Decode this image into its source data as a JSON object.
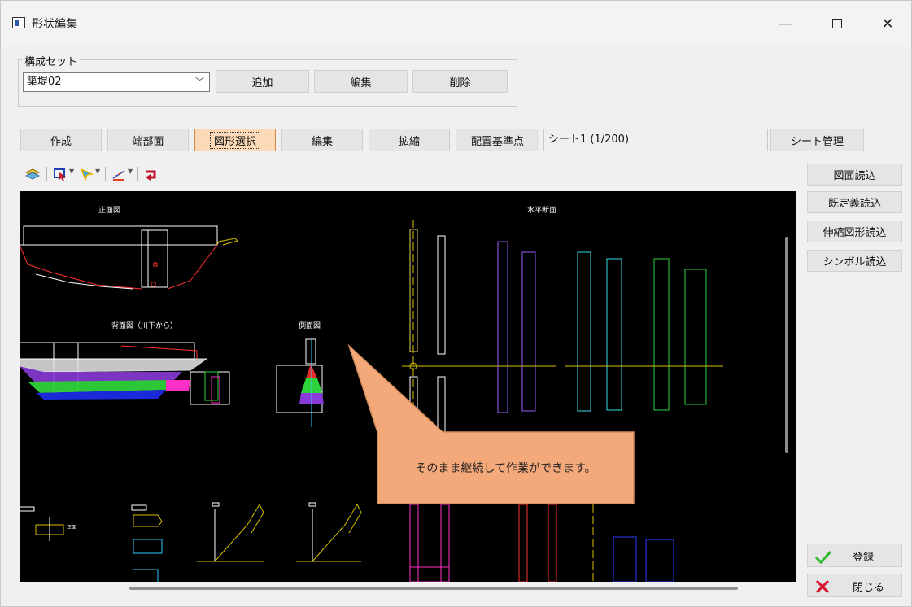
{
  "window": {
    "title": "形状編集"
  },
  "config_set": {
    "legend": "構成セット",
    "selected": "築堤02",
    "add_label": "追加",
    "edit_label": "編集",
    "delete_label": "削除"
  },
  "mode_bar": {
    "create": "作成",
    "end_section": "端部面",
    "shape_select": "図形選択",
    "edit": "編集",
    "scale": "拡縮",
    "base_point": "配置基準点",
    "sheet_value": "シート1 (1/200)",
    "sheet_manage": "シート管理"
  },
  "side_panel": {
    "load_drawing": "図面読込",
    "load_predefined": "既定義読込",
    "load_stretch": "伸縮図形読込",
    "load_symbol": "シンボル読込"
  },
  "footer": {
    "register": "登録",
    "close": "閉じる"
  },
  "drawing": {
    "labels": {
      "front_view": "正面図",
      "horizontal_section": "水平断面",
      "rear_view": "背面図（川下から）",
      "side_view": "側面図",
      "small_front": "正面"
    },
    "callout": "そのまま継続して作業ができます。"
  },
  "colors": {
    "canvas_bg": "#000000",
    "callout_fill": "#f4a97a",
    "callout_stroke": "#d48a5a",
    "selected_btn": "#fdd9b8"
  }
}
